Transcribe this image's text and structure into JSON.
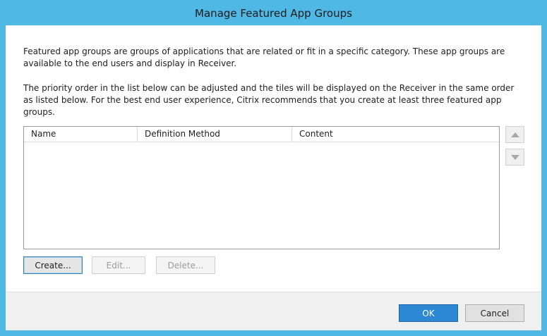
{
  "window": {
    "title": "Manage Featured App Groups"
  },
  "description": {
    "paragraph1": "Featured app groups are groups of applications that are related or fit in a specific category. These app groups are available to the end users and display in Receiver.",
    "paragraph2": "The priority order in the list below can be adjusted and the tiles will be displayed on the Receiver in the same order as listed below. For the best end user experience, Citrix recommends that you create at least three featured app groups."
  },
  "list": {
    "columns": [
      "Name",
      "Definition Method",
      "Content"
    ],
    "rows": []
  },
  "reorder": {
    "up_icon": "triangle-up-icon",
    "down_icon": "triangle-down-icon"
  },
  "actions": {
    "create_label": "Create...",
    "edit_label": "Edit...",
    "delete_label": "Delete..."
  },
  "dialog_buttons": {
    "ok_label": "OK",
    "cancel_label": "Cancel"
  },
  "colors": {
    "frame": "#4fb8e4",
    "primary_button": "#2c88d4",
    "disabled_text": "#9c9c9c"
  }
}
